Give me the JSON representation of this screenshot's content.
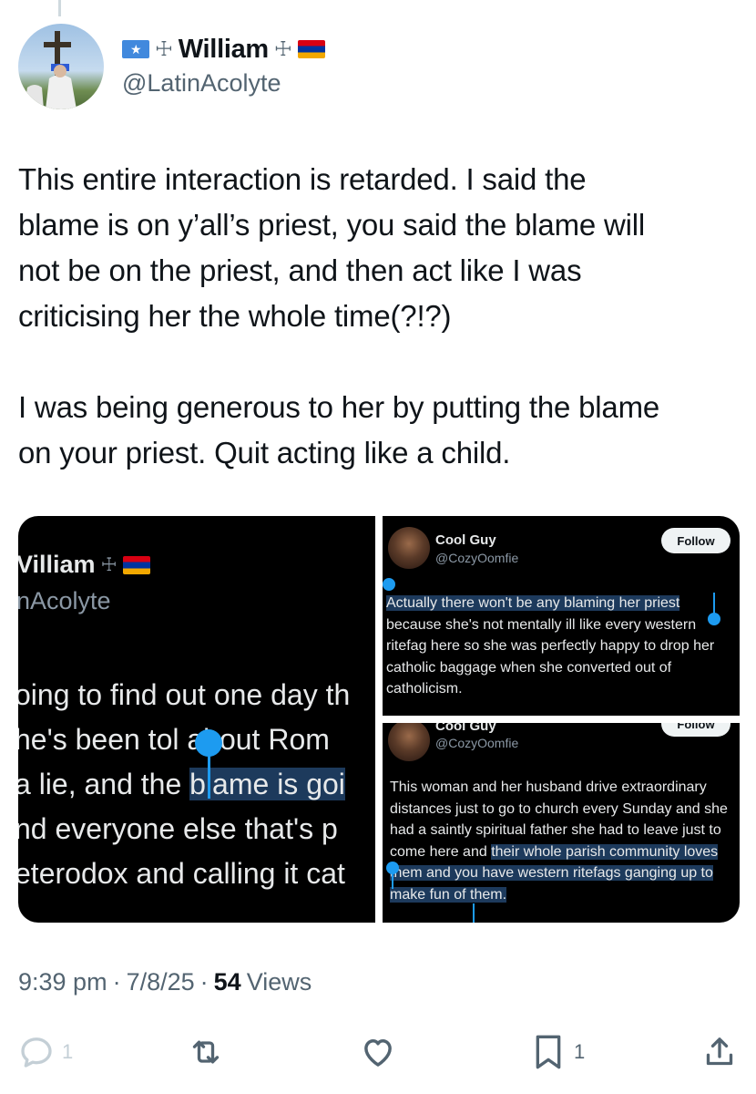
{
  "author": {
    "name": "William",
    "name_prefix_cross": "☩",
    "name_suffix_cross": "☩",
    "flag_left": "somalia-flag",
    "flag_right": "armenia-flag",
    "handle": "@LatinAcolyte"
  },
  "tweet": {
    "text": "This entire interaction is retarded. I said the\nblame is on y’all’s priest, you said the blame will\nnot be on the priest, and then act like I was\ncriticising her the whole time(?!?)\n\nI was being generous to her by putting the blame\non your priest. Quit acting like a child."
  },
  "media": {
    "left_screenshot": {
      "name": "Villiam",
      "cross": "☩",
      "handle": "nAcolyte",
      "lines": [
        {
          "before": "oing to find out one day th",
          "highlight": "",
          "after": ""
        },
        {
          "before": "he's been tol",
          "highlight": "",
          "after": " about Rom"
        },
        {
          "before": "a lie, and the ",
          "highlight": "blame is goi",
          "after": ""
        },
        {
          "before": "nd everyone else that's p",
          "highlight": "",
          "after": ""
        },
        {
          "before": "eterodox and calling it cat",
          "highlight": "",
          "after": ""
        }
      ]
    },
    "right_top": {
      "name": "Cool Guy",
      "handle": "@CozyOomfie",
      "follow_label": "Follow",
      "highlight": "Actually there won't be any blaming her priest",
      "body_rest": "because she's not mentally ill like every western ritefag here so she was perfectly happy to drop her catholic baggage when she converted out of catholicism."
    },
    "right_bottom": {
      "name": "Cool Guy",
      "handle": "@CozyOomfie",
      "follow_label": "Follow",
      "body_plain": "This woman and her husband drive extraordinary distances just to go to church every Sunday and she had a saintly spiritual father she had to leave just to come here and ",
      "highlight": "their whole parish community loves them and you have western ritefags ganging up to make fun of them."
    }
  },
  "meta": {
    "time": "9:39 pm",
    "sep1": "·",
    "date": "7/8/25",
    "sep2": "·",
    "views_count": "54",
    "views_label": "Views"
  },
  "actions": {
    "reply_count": "1",
    "bookmark_count": "1"
  },
  "colors": {
    "accent": "#1d9bf0",
    "text_primary": "#0f1419",
    "text_secondary": "#536471",
    "icon_muted": "#c4cfd6"
  }
}
